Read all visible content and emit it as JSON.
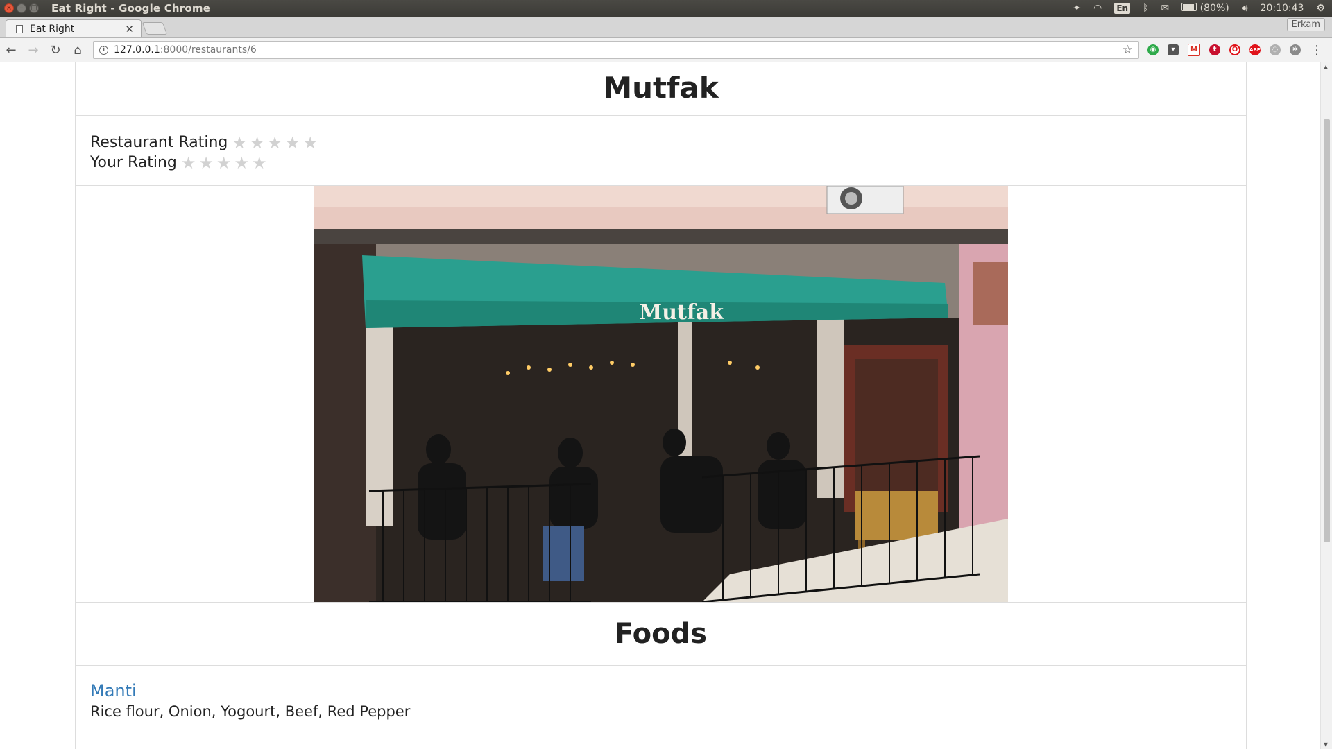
{
  "os": {
    "window_title": "Eat Right - Google Chrome",
    "lang": "En",
    "battery": "(80%)",
    "time": "20:10:43"
  },
  "browser": {
    "tab_title": "Eat Right",
    "profile": "Erkam",
    "url_host": "127.0.0.1",
    "url_path": ":8000/restaurants/6"
  },
  "page": {
    "title": "Mutfak",
    "restaurant_rating_label": "Restaurant Rating",
    "your_rating_label": "Your Rating",
    "restaurant_rating_stars": 0,
    "your_rating_stars": 0,
    "star_empty_color": "#d2d2d2",
    "awning_sign": "Mutfak",
    "foods_heading": "Foods",
    "foods": [
      {
        "name": "Manti",
        "ingredients": "Rice flour, Onion, Yogourt, Beef, Red Pepper"
      }
    ],
    "link_color": "#337ab7"
  }
}
